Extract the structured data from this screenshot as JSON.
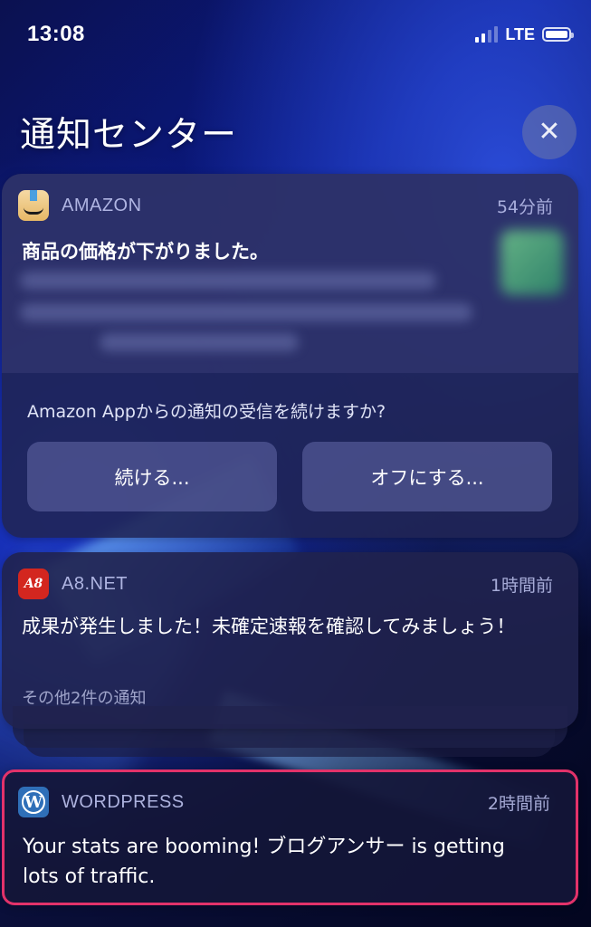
{
  "status_bar": {
    "time": "13:08",
    "network": "LTE"
  },
  "notification_center": {
    "title": "通知センター"
  },
  "notifications": {
    "amazon": {
      "app_name": "AMAZON",
      "time": "54分前",
      "title": "商品の価格が下がりました。",
      "prompt": "Amazon Appからの通知の受信を続けますか?",
      "continue_label": "続ける...",
      "turn_off_label": "オフにする..."
    },
    "a8": {
      "app_name": "A8.NET",
      "icon_text": "A8",
      "time": "1時間前",
      "body": "成果が発生しました！未確定速報を確認してみましょう！",
      "more": "その他2件の通知"
    },
    "wordpress": {
      "app_name": "WORDPRESS",
      "icon_text": "W",
      "time": "2時間前",
      "body": "Your stats are booming! ブログアンサー is getting lots of traffic."
    }
  },
  "colors": {
    "highlight_border": "#e2326a",
    "app_label": "#bec3f0"
  }
}
